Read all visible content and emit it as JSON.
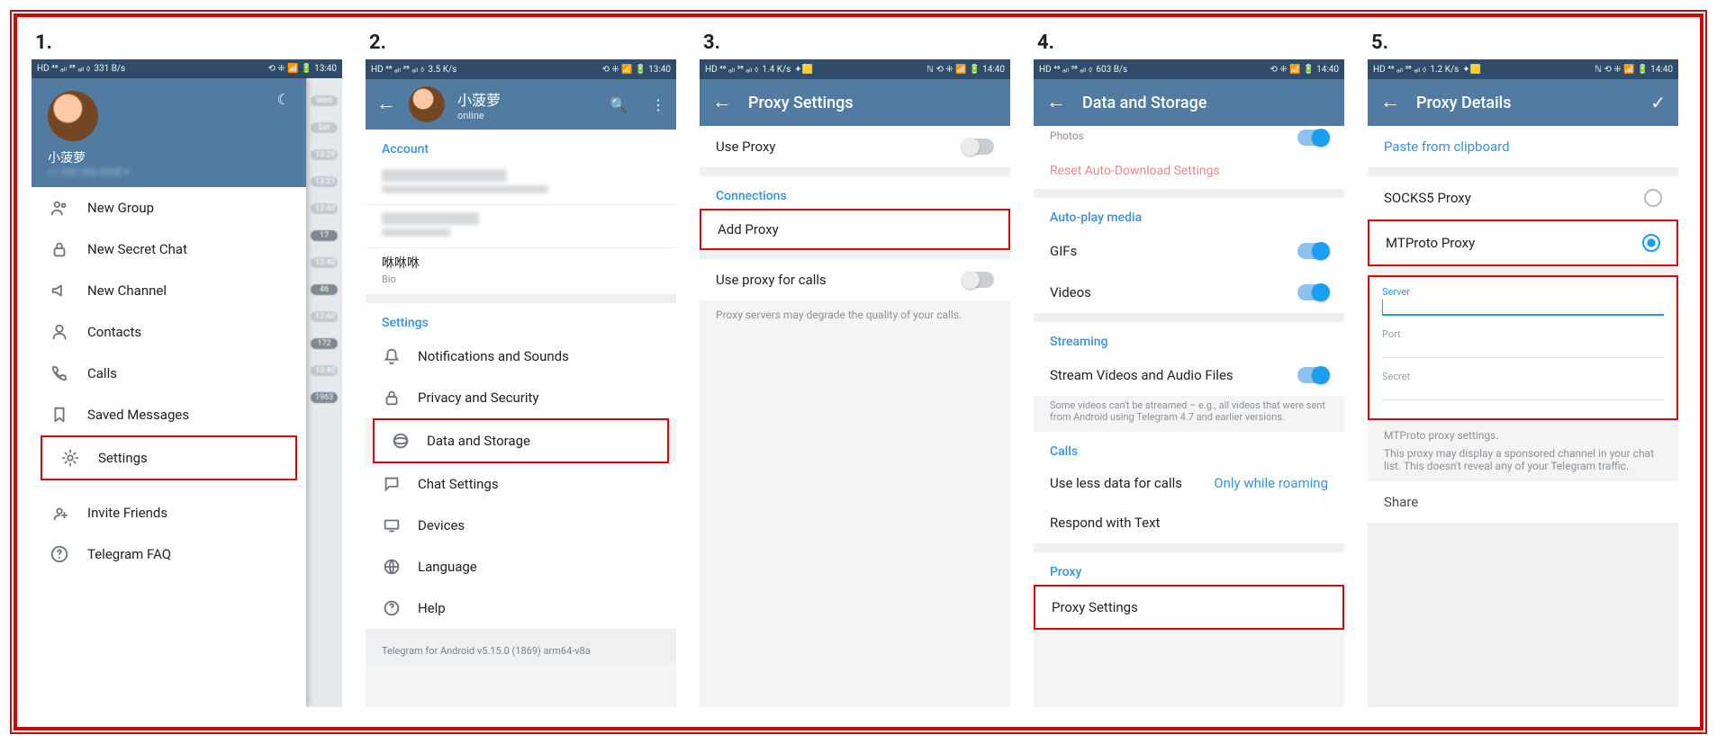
{
  "step_labels": [
    "1.",
    "2.",
    "3.",
    "4.",
    "5."
  ],
  "statusbar": {
    "left_a": "HD ⁴⁶ ₐₗₗ ³⁸ ₐₗₗ ⬨",
    "net_1": "331 B/s",
    "net_2": "3.5 K/s",
    "net_3": "1.4 K/s",
    "net_4": "603 B/s",
    "net_5": "1.2 K/s",
    "right_a": "⟲ ⁜ 📶 🔋 13:40",
    "right_b": "⟲ ⁜ 📶 🔋 14:40",
    "right_n": "ℕ ⟲ ⁜ 📶 🔋 14:40"
  },
  "panel1": {
    "user_name": "小菠萝",
    "menu": [
      "New Group",
      "New Secret Chat",
      "New Channel",
      "Contacts",
      "Calls",
      "Saved Messages",
      "Settings",
      "Invite Friends",
      "Telegram FAQ"
    ],
    "chips": [
      "Wed",
      "Sat",
      "13:28",
      "13:21",
      "13:40",
      "17",
      "13:40",
      "46",
      "13:40",
      "172",
      "13:40",
      "1963"
    ]
  },
  "panel2": {
    "prof_name": "小菠萝",
    "prof_status": "online",
    "account_cap": "Account",
    "bio_main": "咻咻咻",
    "bio_sub": "Bio",
    "settings_cap": "Settings",
    "settings_items": [
      "Notifications and Sounds",
      "Privacy and Security",
      "Data and Storage",
      "Chat Settings",
      "Devices",
      "Language",
      "Help"
    ],
    "version": "Telegram for Android v5.15.0 (1869) arm64-v8a"
  },
  "panel3": {
    "title": "Proxy Settings",
    "use_proxy": "Use Proxy",
    "conn_cap": "Connections",
    "add_proxy": "Add Proxy",
    "use_calls": "Use proxy for calls",
    "calls_note": "Proxy servers may degrade the quality of your calls."
  },
  "panel4": {
    "title": "Data and Storage",
    "photos_tail": "Photos",
    "reset": "Reset Auto-Download Settings",
    "autoplay_cap": "Auto-play media",
    "gifs": "GIFs",
    "videos": "Videos",
    "stream_cap": "Streaming",
    "stream_row": "Stream Videos and Audio Files",
    "stream_note": "Some videos can't be streamed – e.g., all videos that were sent from Android using Telegram 4.7 and earlier versions.",
    "calls_cap": "Calls",
    "less_data": "Use less data for calls",
    "less_data_val": "Only while roaming",
    "respond": "Respond with Text",
    "proxy_cap": "Proxy",
    "proxy_set": "Proxy Settings"
  },
  "panel5": {
    "title": "Proxy Details",
    "paste": "Paste from clipboard",
    "socks": "SOCKS5 Proxy",
    "mtproto": "MTProto Proxy",
    "server_lbl": "Server",
    "port_lbl": "Port",
    "secret_lbl": "Secret",
    "info1": "MTProto proxy settings.",
    "info2": "This proxy may display a sponsored channel in your chat list. This doesn't reveal any of your Telegram traffic.",
    "share": "Share"
  }
}
